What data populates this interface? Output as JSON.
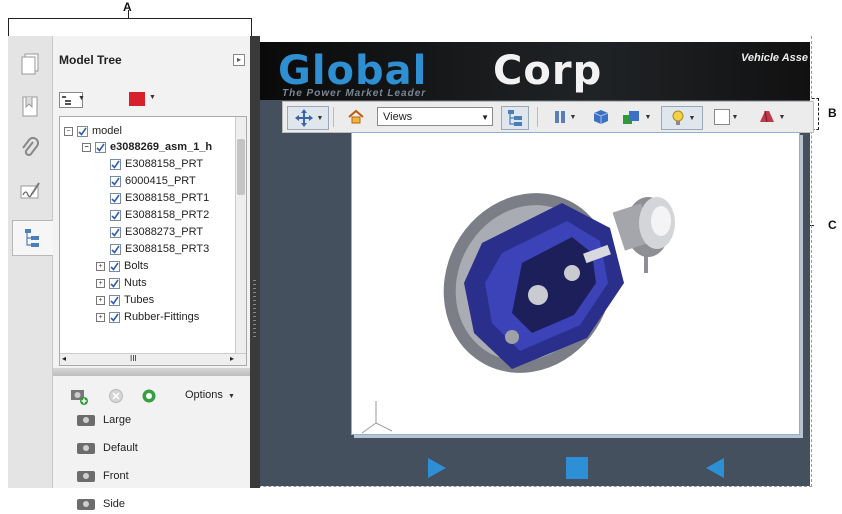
{
  "callouts": {
    "a": "A",
    "b": "B",
    "c": "C"
  },
  "model_tree": {
    "title": "Model Tree",
    "close_symbol": "▸",
    "tree": [
      {
        "label": "model",
        "level": 0,
        "expander": "⊟"
      },
      {
        "label": "e3088269_asm_1_h",
        "level": 1,
        "expander": "⊟",
        "bold": true
      },
      {
        "label": "E3088158_PRT",
        "level": 2
      },
      {
        "label": "6000415_PRT",
        "level": 2
      },
      {
        "label": "E3088158_PRT1",
        "level": 2
      },
      {
        "label": "E3088158_PRT2",
        "level": 2
      },
      {
        "label": "E3088273_PRT",
        "level": 2
      },
      {
        "label": "E3088158_PRT3",
        "level": 2
      },
      {
        "label": "Bolts",
        "level": 1,
        "expander": "+"
      },
      {
        "label": "Nuts",
        "level": 1,
        "expander": "+"
      },
      {
        "label": "Tubes",
        "level": 1,
        "expander": "+"
      },
      {
        "label": "Rubber-Fittings",
        "level": 1,
        "expander": "+"
      }
    ],
    "hscroll_label": "III",
    "options_label": "Options",
    "views": [
      "Large",
      "Default",
      "Front",
      "Side"
    ]
  },
  "banner": {
    "logo_part1": "Global",
    "logo_part2": "Corp",
    "right_text": "Vehicle Asse",
    "sub_text": "The Power Market Leader"
  },
  "toolbar3d": {
    "views_select": "Views"
  },
  "colors": {
    "brand_blue": "#2e8fd2",
    "red_swatch": "#d8202a",
    "part_blue": "#2b2f8c",
    "play_blue": "#2d8fd6"
  }
}
